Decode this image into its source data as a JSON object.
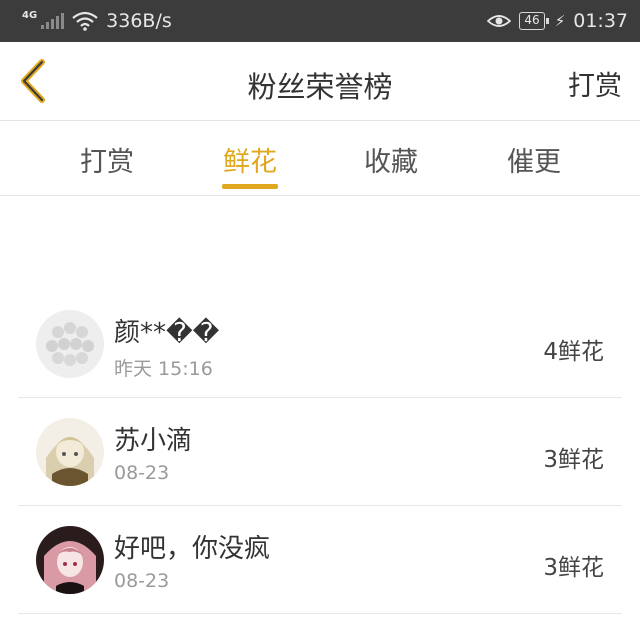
{
  "status_bar": {
    "network_type": "4G",
    "speed": "336B/s",
    "battery": "46",
    "time": "01:37",
    "icons": [
      "signal-icon",
      "wifi-icon",
      "eye-icon",
      "battery-icon",
      "charging-icon"
    ]
  },
  "header": {
    "back_icon": "chevron-left-icon",
    "title": "粉丝荣誉榜",
    "action_label": "打赏"
  },
  "tabs": [
    {
      "label": "打赏",
      "active": false
    },
    {
      "label": "鲜花",
      "active": true
    },
    {
      "label": "收藏",
      "active": false
    },
    {
      "label": "催更",
      "active": false
    }
  ],
  "ranking": [
    {
      "name": "颜**��",
      "time": "昨天 15:16",
      "count": "4鲜花"
    },
    {
      "name": "苏小滴",
      "time": "08-23",
      "count": "3鲜花"
    },
    {
      "name": "好吧，你没疯",
      "time": "08-23",
      "count": "3鲜花"
    }
  ],
  "colors": {
    "accent": "#e0a81e",
    "status_bar": "#3c3c3c",
    "divider": "#e4e4e4"
  }
}
